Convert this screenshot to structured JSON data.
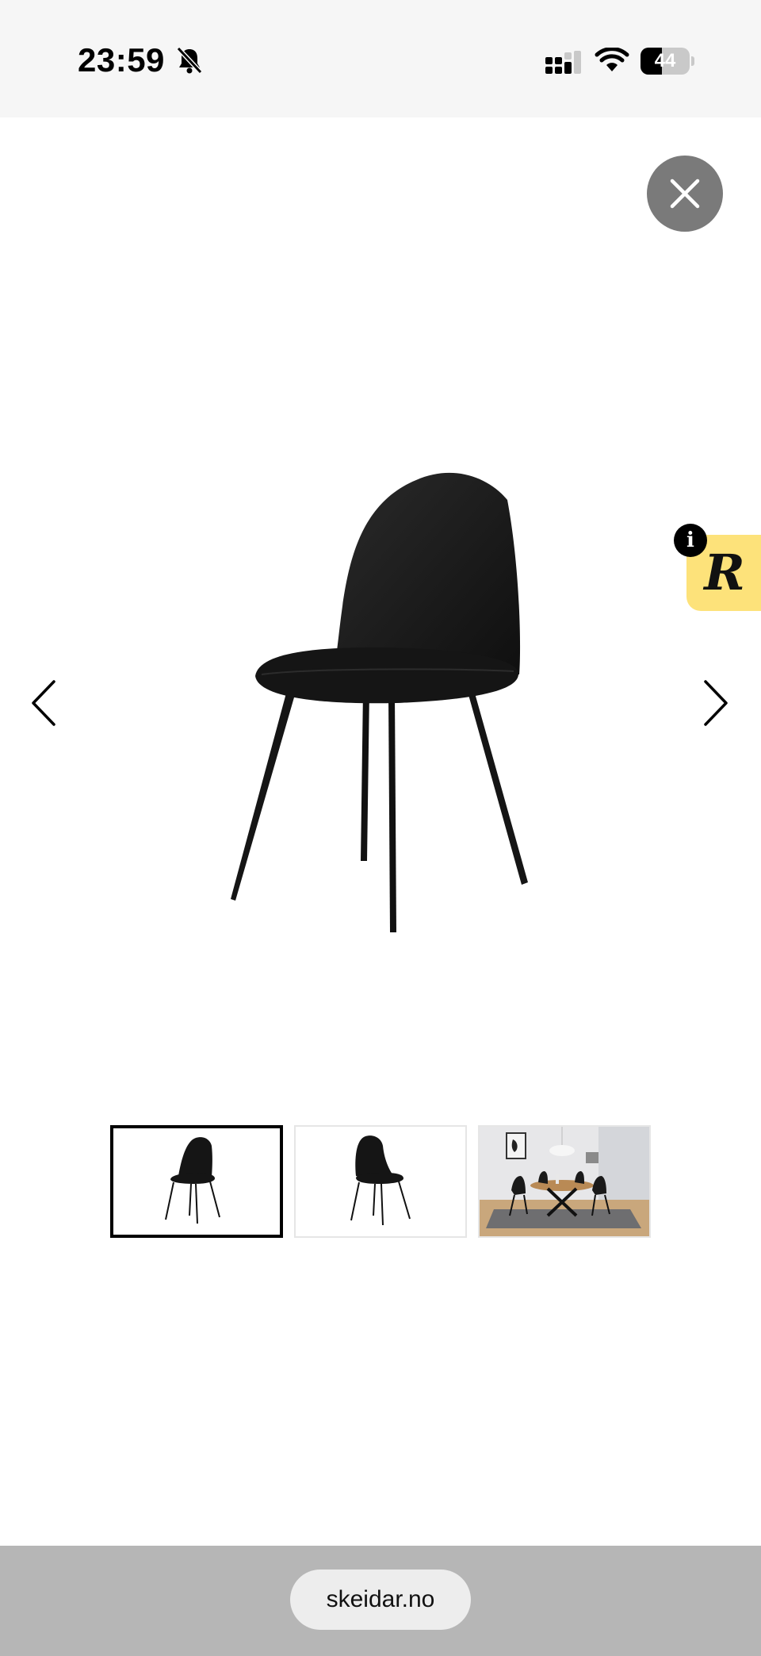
{
  "status_bar": {
    "time": "23:59",
    "battery_level": "44",
    "icons": [
      "bell-slash-icon",
      "signal-icon",
      "wifi-icon",
      "battery-icon"
    ]
  },
  "gallery": {
    "close_icon": "close-icon",
    "prev_icon": "chevron-left-icon",
    "next_icon": "chevron-right-icon",
    "main_image": "black-chair",
    "active_thumbnail": 1,
    "thumbnails": [
      {
        "name": "black-chair"
      },
      {
        "name": "black-chair"
      },
      {
        "name": "dining-room"
      }
    ]
  },
  "widget": {
    "info_label": "i",
    "logo_letter": "R",
    "background": "#fde27a"
  },
  "browser": {
    "url": "skeidar.no"
  }
}
